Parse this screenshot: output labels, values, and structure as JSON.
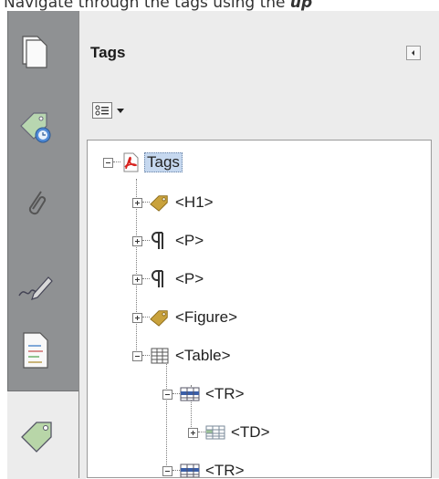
{
  "caption": {
    "text_before": "Navigate through the tags using the ",
    "text_bold": "up"
  },
  "rail": {
    "icons": [
      "pages-icon",
      "attachments-tag-icon",
      "paperclip-icon",
      "signature-icon",
      "content-icon",
      "tags-panel-icon"
    ]
  },
  "panel": {
    "title": "Tags",
    "collapse_label": "Collapse panel",
    "options_icon": "tag-options-icon"
  },
  "tree": {
    "nodes": [
      {
        "label": "Tags",
        "icon": "pdf-icon",
        "toggle": "minus",
        "selected": true
      },
      {
        "label": "<H1>",
        "icon": "tag-icon",
        "toggle": "plus"
      },
      {
        "label": "<P>",
        "icon": "paragraph-icon",
        "toggle": "plus"
      },
      {
        "label": "<P>",
        "icon": "paragraph-icon",
        "toggle": "plus"
      },
      {
        "label": "<Figure>",
        "icon": "tag-icon",
        "toggle": "plus"
      },
      {
        "label": "<Table>",
        "icon": "table-icon",
        "toggle": "minus"
      },
      {
        "label": "<TR>",
        "icon": "table-row-icon",
        "toggle": "minus"
      },
      {
        "label": "<TD>",
        "icon": "table-cell-icon",
        "toggle": "plus"
      },
      {
        "label": "<TR>",
        "icon": "table-row-icon",
        "toggle": "minus"
      }
    ]
  },
  "colors": {
    "rail": "#8f9193",
    "panel": "#ececec",
    "selection": "#c6d8ef",
    "tag_gold": "#c9a23c",
    "pdf_red": "#d8231f"
  }
}
